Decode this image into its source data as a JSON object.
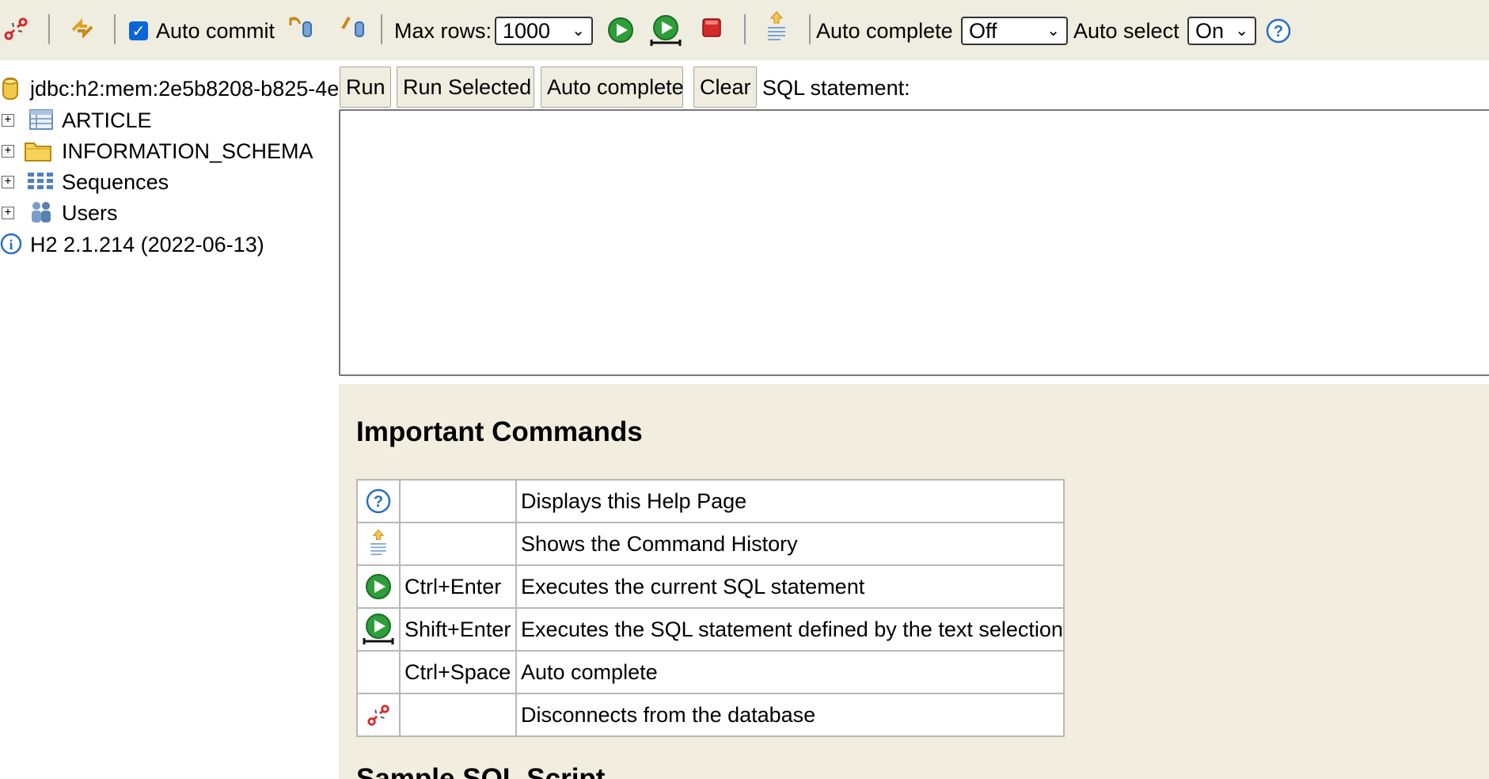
{
  "toolbar": {
    "disconnect_icon": "disconnect-icon",
    "refresh_icon": "refresh-icon",
    "auto_commit_label": "Auto commit",
    "auto_commit_checked": true,
    "rollback_icon": "rollback-icon",
    "commit_icon": "commit-icon",
    "max_rows_label": "Max rows:",
    "max_rows_value": "1000",
    "run_icon": "run-icon",
    "run_selected_icon": "run-selected-icon",
    "stop_icon": "stop-icon",
    "history_icon": "history-icon",
    "auto_complete_label": "Auto complete",
    "auto_complete_value": "Off",
    "auto_select_label": "Auto select",
    "auto_select_value": "On",
    "help_icon": "help-icon"
  },
  "tree": {
    "connection": "jdbc:h2:mem:2e5b8208-b825-4e",
    "items": [
      {
        "label": "ARTICLE",
        "icon": "table-icon"
      },
      {
        "label": "INFORMATION_SCHEMA",
        "icon": "folder-icon"
      },
      {
        "label": "Sequences",
        "icon": "sequences-icon"
      },
      {
        "label": "Users",
        "icon": "users-icon"
      }
    ],
    "version": "H2 2.1.214 (2022-06-13)"
  },
  "query": {
    "buttons": {
      "run": "Run",
      "run_selected": "Run Selected",
      "auto_complete": "Auto complete",
      "clear": "Clear"
    },
    "sql_label": "SQL statement:",
    "sql_value": ""
  },
  "help": {
    "title": "Important Commands",
    "commands": [
      {
        "icon": "help-icon",
        "key": "",
        "description": "Displays this Help Page"
      },
      {
        "icon": "history-icon",
        "key": "",
        "description": "Shows the Command History"
      },
      {
        "icon": "run-icon",
        "key": "Ctrl+Enter",
        "description": "Executes the current SQL statement"
      },
      {
        "icon": "run-selected-icon",
        "key": "Shift+Enter",
        "description": "Executes the SQL statement defined by the text selection"
      },
      {
        "icon": "",
        "key": "Ctrl+Space",
        "description": "Auto complete"
      },
      {
        "icon": "disconnect-icon",
        "key": "",
        "description": "Disconnects from the database"
      }
    ],
    "sample_title": "Sample SQL Script"
  },
  "colors": {
    "toolbar_bg": "#efece0",
    "help_bg": "#f1eedf",
    "run_green": "#2e9e3a",
    "stop_red": "#d42a2a",
    "checkbox_blue": "#0a66d8",
    "help_blue": "#2a6fbd"
  }
}
